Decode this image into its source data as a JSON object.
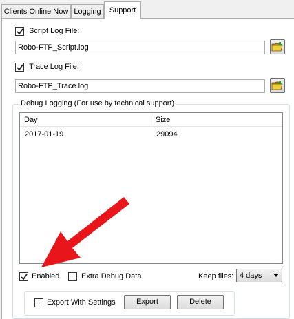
{
  "tabs": [
    {
      "label": "Clients Online Now"
    },
    {
      "label": "Logging"
    },
    {
      "label": "Support"
    }
  ],
  "script_log": {
    "checkbox_label": "Script Log File:",
    "checked": true,
    "value": "Robo-FTP_Script.log"
  },
  "trace_log": {
    "checkbox_label": "Trace Log File:",
    "checked": true,
    "value": "Robo-FTP_Trace.log"
  },
  "debug": {
    "group_title": "Debug Logging (For use by technical support)",
    "columns": [
      "Day",
      "Size"
    ],
    "rows": [
      {
        "day": "2017-01-19",
        "size": "29094"
      }
    ],
    "enabled_label": "Enabled",
    "enabled_checked": true,
    "extra_label": "Extra Debug Data",
    "extra_checked": false,
    "keep_files_label": "Keep files:",
    "keep_files_value": "4 days",
    "export_settings_label": "Export With Settings",
    "export_settings_checked": false,
    "export_button": "Export",
    "delete_button": "Delete"
  },
  "colors": {
    "arrow": "#e8151b",
    "selected_tab_bg": "#ffffff"
  },
  "icons": [
    "folder-open-icon",
    "checkmark-icon",
    "dropdown-arrow-icon",
    "red-arrow-annotation"
  ]
}
